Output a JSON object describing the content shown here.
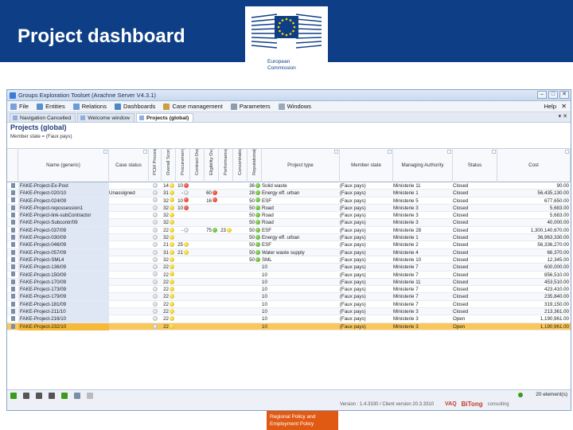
{
  "slide": {
    "title": "Project dashboard",
    "logo_text_line1": "European",
    "logo_text_line2": "Commission",
    "footer_line1": "Regional Policy and",
    "footer_line2": "Employment Policy"
  },
  "app": {
    "window_title": "Groups Exploration Toolset (Arachne Server V4.3.1)",
    "menu": [
      {
        "label": "File",
        "icon": "file-icon",
        "color": "#7aa0d8"
      },
      {
        "label": "Entities",
        "icon": "entities-icon",
        "color": "#5a8fd0"
      },
      {
        "label": "Relations",
        "icon": "relations-icon",
        "color": "#6c9bd6"
      },
      {
        "label": "Dashboards",
        "icon": "dashboards-icon",
        "color": "#4f86c6"
      },
      {
        "label": "Case management",
        "icon": "case-management-icon",
        "color": "#c8a040"
      },
      {
        "label": "Parameters",
        "icon": "parameters-icon",
        "color": "#8c9bb0"
      },
      {
        "label": "Windows",
        "icon": "windows-icon",
        "color": "#9aa8bc"
      }
    ],
    "help_label": "Help",
    "tabs": [
      {
        "label": "Navigation Cancelled"
      },
      {
        "label": "Welcome window"
      },
      {
        "label": "Projects (global)"
      }
    ],
    "panel_title": "Projects (global)",
    "filter_text": "Member state = (Faux pays)",
    "columns": [
      {
        "label": "",
        "vertical": false
      },
      {
        "label": "Name (generic)",
        "vertical": false
      },
      {
        "label": "Case status",
        "vertical": false
      },
      {
        "label": "PCM Process Score",
        "vertical": true
      },
      {
        "label": "Overall Score",
        "vertical": true
      },
      {
        "label": "Procurement Overall Score",
        "vertical": true
      },
      {
        "label": "Contract Overall Score",
        "vertical": true
      },
      {
        "label": "Eligibility Overall Score",
        "vertical": true
      },
      {
        "label": "Performance Overall Score",
        "vertical": true
      },
      {
        "label": "Concentration Overall Score",
        "vertical": true
      },
      {
        "label": "Reputational Overall Score",
        "vertical": true
      },
      {
        "label": "Project type",
        "vertical": false
      },
      {
        "label": "Member state",
        "vertical": false
      },
      {
        "label": "Managing Authority",
        "vertical": false
      },
      {
        "label": "Status",
        "vertical": false
      },
      {
        "label": "Cost",
        "vertical": false
      }
    ],
    "rows": [
      {
        "name": "FAKE-Project-Ex-Post",
        "case": "",
        "pcm": "grey",
        "ov": [
          "14",
          "yellow"
        ],
        "pr": [
          "10",
          "red"
        ],
        "co": [
          "",
          ""
        ],
        "el": [
          "",
          ""
        ],
        "pe": [
          "",
          ""
        ],
        "cn": [
          "",
          ""
        ],
        "re": [
          "36",
          "green"
        ],
        "type": "Solid waste",
        "ms": "(Faux pays)",
        "ma": "Ministerie 11",
        "status": "Closed",
        "cost": "90.00"
      },
      {
        "name": "FAKE-Project-020/10",
        "case": "Unassigned",
        "pcm": "grey",
        "ov": [
          "31",
          "yellow"
        ],
        "pr": [
          "-",
          "grey"
        ],
        "co": [
          "",
          ""
        ],
        "el": [
          "60",
          "red"
        ],
        "pe": [
          "",
          ""
        ],
        "cn": [
          "",
          ""
        ],
        "re": [
          "28",
          "green"
        ],
        "type": "Energy eff. urban",
        "ms": "(Faux pays)",
        "ma": "Ministerie 1",
        "status": "Closed",
        "cost": "56,435,130.00"
      },
      {
        "name": "FAKE-Project-024/09",
        "case": "",
        "pcm": "grey",
        "ov": [
          "32",
          "yellow"
        ],
        "pr": [
          "10",
          "red"
        ],
        "co": [
          "",
          ""
        ],
        "el": [
          "16",
          "red"
        ],
        "pe": [
          "",
          ""
        ],
        "cn": [
          "",
          ""
        ],
        "re": [
          "50",
          "green"
        ],
        "type": "ESF",
        "ms": "(Faux pays)",
        "ma": "Ministerie 5",
        "status": "Closed",
        "cost": "677,650.00"
      },
      {
        "name": "FAKE-Project-repossession1",
        "case": "",
        "pcm": "grey",
        "ov": [
          "32",
          "yellow"
        ],
        "pr": [
          "10",
          "red"
        ],
        "co": [
          "",
          ""
        ],
        "el": [
          "",
          ""
        ],
        "pe": [
          "",
          ""
        ],
        "cn": [
          "",
          ""
        ],
        "re": [
          "50",
          "green"
        ],
        "type": "Road",
        "ms": "(Faux pays)",
        "ma": "Ministerie 3",
        "status": "Closed",
        "cost": "5,683.00"
      },
      {
        "name": "FAKE-Project-link-subContractor",
        "case": "",
        "pcm": "grey",
        "ov": [
          "32",
          "yellow"
        ],
        "pr": [
          "",
          ""
        ],
        "co": [
          "",
          ""
        ],
        "el": [
          "",
          ""
        ],
        "pe": [
          "",
          ""
        ],
        "cn": [
          "",
          ""
        ],
        "re": [
          "50",
          "green"
        ],
        "type": "Road",
        "ms": "(Faux pays)",
        "ma": "Ministerie 3",
        "status": "Closed",
        "cost": "5,683.00"
      },
      {
        "name": "FAKE-Project-Subcontr/09",
        "case": "",
        "pcm": "grey",
        "ov": [
          "32",
          "yellow"
        ],
        "pr": [
          "",
          ""
        ],
        "co": [
          "",
          ""
        ],
        "el": [
          "",
          ""
        ],
        "pe": [
          "",
          ""
        ],
        "cn": [
          "",
          ""
        ],
        "re": [
          "50",
          "green"
        ],
        "type": "Road",
        "ms": "(Faux pays)",
        "ma": "Ministerie 3",
        "status": "Closed",
        "cost": "40,000.00"
      },
      {
        "name": "FAKE-Project-037/09",
        "case": "",
        "pcm": "grey",
        "ov": [
          "22",
          "yellow"
        ],
        "pr": [
          "-",
          "grey"
        ],
        "co": [
          "",
          ""
        ],
        "el": [
          "75",
          "green"
        ],
        "pe": [
          "23",
          "yellow"
        ],
        "cn": [
          "",
          ""
        ],
        "re": [
          "50",
          "green"
        ],
        "type": "ESF",
        "ms": "(Faux pays)",
        "ma": "Ministerie 28",
        "status": "Closed",
        "cost": "1,300,140,670.00"
      },
      {
        "name": "FAKE-Project-030/09",
        "case": "",
        "pcm": "grey",
        "ov": [
          "32",
          "yellow"
        ],
        "pr": [
          "",
          ""
        ],
        "co": [
          "",
          ""
        ],
        "el": [
          "",
          ""
        ],
        "pe": [
          "",
          ""
        ],
        "cn": [
          "",
          ""
        ],
        "re": [
          "50",
          "green"
        ],
        "type": "Energy eff. urban",
        "ms": "(Faux pays)",
        "ma": "Ministerie 1",
        "status": "Closed",
        "cost": "36,963,330.00"
      },
      {
        "name": "FAKE-Project-046/09",
        "case": "",
        "pcm": "grey",
        "ov": [
          "21",
          "yellow"
        ],
        "pr": [
          "25",
          "yellow"
        ],
        "co": [
          "",
          ""
        ],
        "el": [
          "",
          ""
        ],
        "pe": [
          "",
          ""
        ],
        "cn": [
          "",
          ""
        ],
        "re": [
          "50",
          "green"
        ],
        "type": "ESF",
        "ms": "(Faux pays)",
        "ma": "Ministerie 2",
        "status": "Closed",
        "cost": "56,336,270.00"
      },
      {
        "name": "FAKE-Project-057/09",
        "case": "",
        "pcm": "grey",
        "ov": [
          "31",
          "yellow"
        ],
        "pr": [
          "21",
          "yellow"
        ],
        "co": [
          "",
          ""
        ],
        "el": [
          "",
          ""
        ],
        "pe": [
          "",
          ""
        ],
        "cn": [
          "",
          ""
        ],
        "re": [
          "50",
          "green"
        ],
        "type": "Water waste supply",
        "ms": "(Faux pays)",
        "ma": "Ministerie 4",
        "status": "Closed",
        "cost": "66,370.00"
      },
      {
        "name": "FAKE-Project-SML4",
        "case": "",
        "pcm": "grey",
        "ov": [
          "32",
          "yellow"
        ],
        "pr": [
          "",
          ""
        ],
        "co": [
          "",
          ""
        ],
        "el": [
          "",
          ""
        ],
        "pe": [
          "",
          ""
        ],
        "cn": [
          "",
          ""
        ],
        "re": [
          "50",
          "green"
        ],
        "type": "SML",
        "ms": "(Faux pays)",
        "ma": "Ministerie 10",
        "status": "Closed",
        "cost": "12,345.00"
      },
      {
        "name": "FAKE-Project-136/09",
        "case": "",
        "pcm": "grey",
        "ov": [
          "22",
          "yellow"
        ],
        "pr": [
          "",
          ""
        ],
        "co": [
          "",
          ""
        ],
        "el": [
          "",
          ""
        ],
        "pe": [
          "",
          ""
        ],
        "cn": [
          "",
          ""
        ],
        "re": [
          "",
          ""
        ],
        "type": "10",
        "ms": "(Faux pays)",
        "ma": "Ministerie 7",
        "status": "Closed",
        "cost": "600,000.00"
      },
      {
        "name": "FAKE-Project-150/09",
        "case": "",
        "pcm": "grey",
        "ov": [
          "22",
          "yellow"
        ],
        "pr": [
          "",
          ""
        ],
        "co": [
          "",
          ""
        ],
        "el": [
          "",
          ""
        ],
        "pe": [
          "",
          ""
        ],
        "cn": [
          "",
          ""
        ],
        "re": [
          "",
          ""
        ],
        "type": "10",
        "ms": "(Faux pays)",
        "ma": "Ministerie 7",
        "status": "Closed",
        "cost": "856,510.00"
      },
      {
        "name": "FAKE-Project-170/09",
        "case": "",
        "pcm": "grey",
        "ov": [
          "22",
          "yellow"
        ],
        "pr": [
          "",
          ""
        ],
        "co": [
          "",
          ""
        ],
        "el": [
          "",
          ""
        ],
        "pe": [
          "",
          ""
        ],
        "cn": [
          "",
          ""
        ],
        "re": [
          "",
          ""
        ],
        "type": "10",
        "ms": "(Faux pays)",
        "ma": "Ministerie 11",
        "status": "Closed",
        "cost": "453,510.00"
      },
      {
        "name": "FAKE-Project-173/09",
        "case": "",
        "pcm": "grey",
        "ov": [
          "22",
          "yellow"
        ],
        "pr": [
          "",
          ""
        ],
        "co": [
          "",
          ""
        ],
        "el": [
          "",
          ""
        ],
        "pe": [
          "",
          ""
        ],
        "cn": [
          "",
          ""
        ],
        "re": [
          "",
          ""
        ],
        "type": "10",
        "ms": "(Faux pays)",
        "ma": "Ministerie 7",
        "status": "Closed",
        "cost": "423,410.00"
      },
      {
        "name": "FAKE-Project-179/09",
        "case": "",
        "pcm": "grey",
        "ov": [
          "22",
          "yellow"
        ],
        "pr": [
          "",
          ""
        ],
        "co": [
          "",
          ""
        ],
        "el": [
          "",
          ""
        ],
        "pe": [
          "",
          ""
        ],
        "cn": [
          "",
          ""
        ],
        "re": [
          "",
          ""
        ],
        "type": "10",
        "ms": "(Faux pays)",
        "ma": "Ministerie 7",
        "status": "Closed",
        "cost": "235,840.00"
      },
      {
        "name": "FAKE-Project-181/09",
        "case": "",
        "pcm": "grey",
        "ov": [
          "22",
          "yellow"
        ],
        "pr": [
          "",
          ""
        ],
        "co": [
          "",
          ""
        ],
        "el": [
          "",
          ""
        ],
        "pe": [
          "",
          ""
        ],
        "cn": [
          "",
          ""
        ],
        "re": [
          "",
          ""
        ],
        "type": "10",
        "ms": "(Faux pays)",
        "ma": "Ministerie 7",
        "status": "Closed",
        "cost": "319,150.00"
      },
      {
        "name": "FAKE-Project-211/10",
        "case": "",
        "pcm": "grey",
        "ov": [
          "22",
          "yellow"
        ],
        "pr": [
          "",
          ""
        ],
        "co": [
          "",
          ""
        ],
        "el": [
          "",
          ""
        ],
        "pe": [
          "",
          ""
        ],
        "cn": [
          "",
          ""
        ],
        "re": [
          "",
          ""
        ],
        "type": "10",
        "ms": "(Faux pays)",
        "ma": "Ministerie 3",
        "status": "Closed",
        "cost": "213,361.00"
      },
      {
        "name": "FAKE-Project-216/10",
        "case": "",
        "pcm": "grey",
        "ov": [
          "22",
          "yellow"
        ],
        "pr": [
          "",
          ""
        ],
        "co": [
          "",
          ""
        ],
        "el": [
          "",
          ""
        ],
        "pe": [
          "",
          ""
        ],
        "cn": [
          "",
          ""
        ],
        "re": [
          "",
          ""
        ],
        "type": "10",
        "ms": "(Faux pays)",
        "ma": "Ministerie 3",
        "status": "Open",
        "cost": "1,190,961.00"
      },
      {
        "name": "FAKE-Project-232/10",
        "case": "",
        "pcm": "grey",
        "ov": [
          "22",
          "yellow"
        ],
        "pr": [
          "",
          ""
        ],
        "co": [
          "",
          ""
        ],
        "el": [
          "",
          ""
        ],
        "pe": [
          "",
          ""
        ],
        "cn": [
          "",
          ""
        ],
        "re": [
          "",
          ""
        ],
        "type": "10",
        "ms": "(Faux pays)",
        "ma": "Ministerie 3",
        "status": "Open",
        "cost": "1,190,961.00"
      }
    ],
    "selected_row": 19,
    "statusbar": {
      "count": "20 element(s)",
      "version": "Version : 1.4.3330 / Client version 20.3.3310",
      "logo1": "VAQ",
      "logo2": "BiTong",
      "logo3": "consulting"
    },
    "colors": {
      "header_blue": "#0e3f86",
      "selected_row": "#fbc75a",
      "footer_orange": "#e05a14"
    }
  }
}
